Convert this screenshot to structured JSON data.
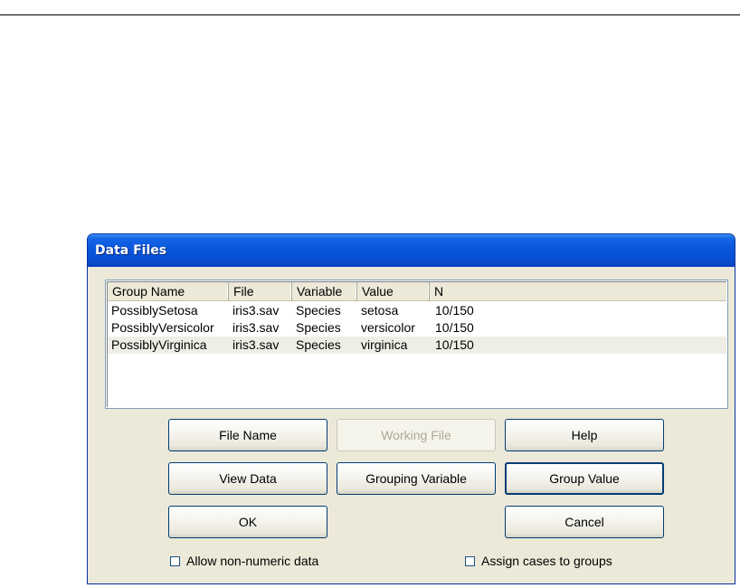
{
  "window": {
    "title": "Data Files"
  },
  "list": {
    "columns": [
      "Group Name",
      "File",
      "Variable",
      "Value",
      "N"
    ],
    "rows": [
      [
        "PossiblySetosa",
        "iris3.sav",
        "Species",
        "setosa",
        "10/150"
      ],
      [
        "PossiblyVersicolor",
        "iris3.sav",
        "Species",
        "versicolor",
        "10/150"
      ],
      [
        "PossiblyVirginica",
        "iris3.sav",
        "Species",
        "virginica",
        "10/150"
      ]
    ],
    "highlighted_row": 2
  },
  "buttons": {
    "file_name": "File Name",
    "working_file": "Working File",
    "help": "Help",
    "view_data": "View Data",
    "grouping_variable": "Grouping Variable",
    "group_value": "Group Value",
    "ok": "OK",
    "cancel": "Cancel"
  },
  "checkboxes": {
    "allow_non_numeric": {
      "label": "Allow non-numeric data",
      "checked": false
    },
    "assign_cases": {
      "label": "Assign cases to groups",
      "checked": false
    }
  },
  "colors": {
    "titlebar": "#0a55da",
    "dialog_face": "#ece9d8",
    "highlight_row": "#efeee6"
  }
}
